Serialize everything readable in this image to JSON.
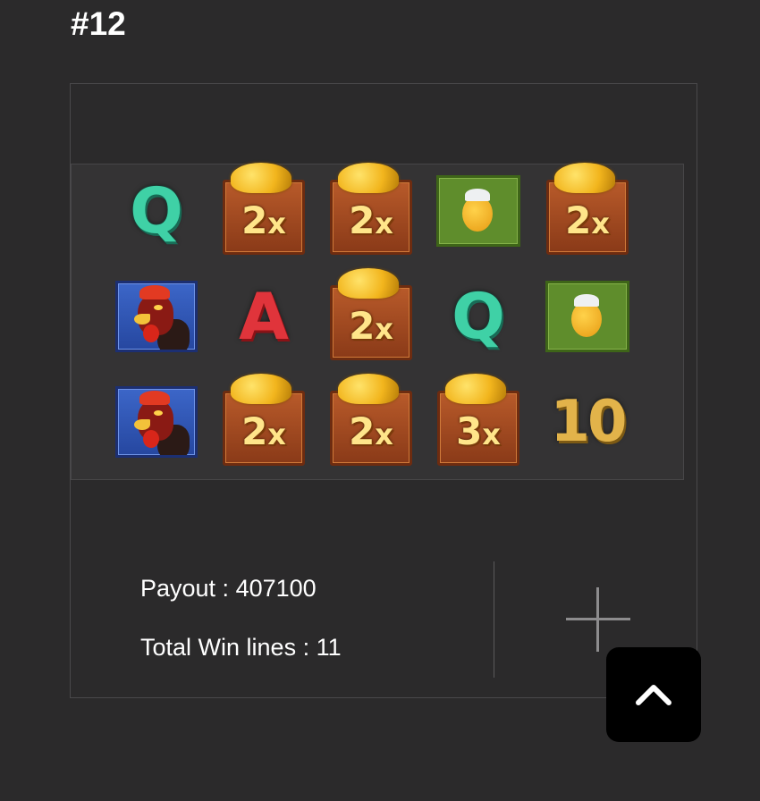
{
  "title": "#12",
  "reels": {
    "rows": [
      [
        {
          "kind": "letter",
          "label": "Q",
          "icon": "q-symbol-icon"
        },
        {
          "kind": "mult",
          "num": "2",
          "x": "x",
          "icon": "gold-multiplier-2x-icon"
        },
        {
          "kind": "mult",
          "num": "2",
          "x": "x",
          "icon": "gold-multiplier-2x-icon"
        },
        {
          "kind": "chick",
          "icon": "chick-symbol-icon"
        },
        {
          "kind": "mult",
          "num": "2",
          "x": "x",
          "icon": "gold-multiplier-2x-icon"
        }
      ],
      [
        {
          "kind": "rooster",
          "icon": "rooster-symbol-icon"
        },
        {
          "kind": "letter-a",
          "label": "A",
          "icon": "a-symbol-icon"
        },
        {
          "kind": "mult",
          "num": "2",
          "x": "x",
          "icon": "gold-multiplier-2x-icon"
        },
        {
          "kind": "letter",
          "label": "Q",
          "icon": "q-symbol-icon"
        },
        {
          "kind": "chick",
          "icon": "chick-symbol-icon"
        }
      ],
      [
        {
          "kind": "rooster",
          "icon": "rooster-symbol-icon"
        },
        {
          "kind": "mult",
          "num": "2",
          "x": "x",
          "icon": "gold-multiplier-2x-icon"
        },
        {
          "kind": "mult",
          "num": "2",
          "x": "x",
          "icon": "gold-multiplier-2x-icon"
        },
        {
          "kind": "mult",
          "num": "3",
          "x": "x",
          "icon": "gold-multiplier-3x-icon"
        },
        {
          "kind": "ten",
          "label": "10",
          "icon": "ten-symbol-icon"
        }
      ]
    ]
  },
  "stats": {
    "payout": "Payout : 407100",
    "win_lines": "Total Win lines : 11"
  },
  "controls": {
    "expand_icon": "plus-icon",
    "scroll_top_icon": "chevron-up-icon"
  },
  "colors": {
    "background": "#2b2a2b",
    "q_symbol": "#3fd1a6",
    "a_symbol": "#e0343b",
    "ten_symbol": "#e2b34a"
  }
}
